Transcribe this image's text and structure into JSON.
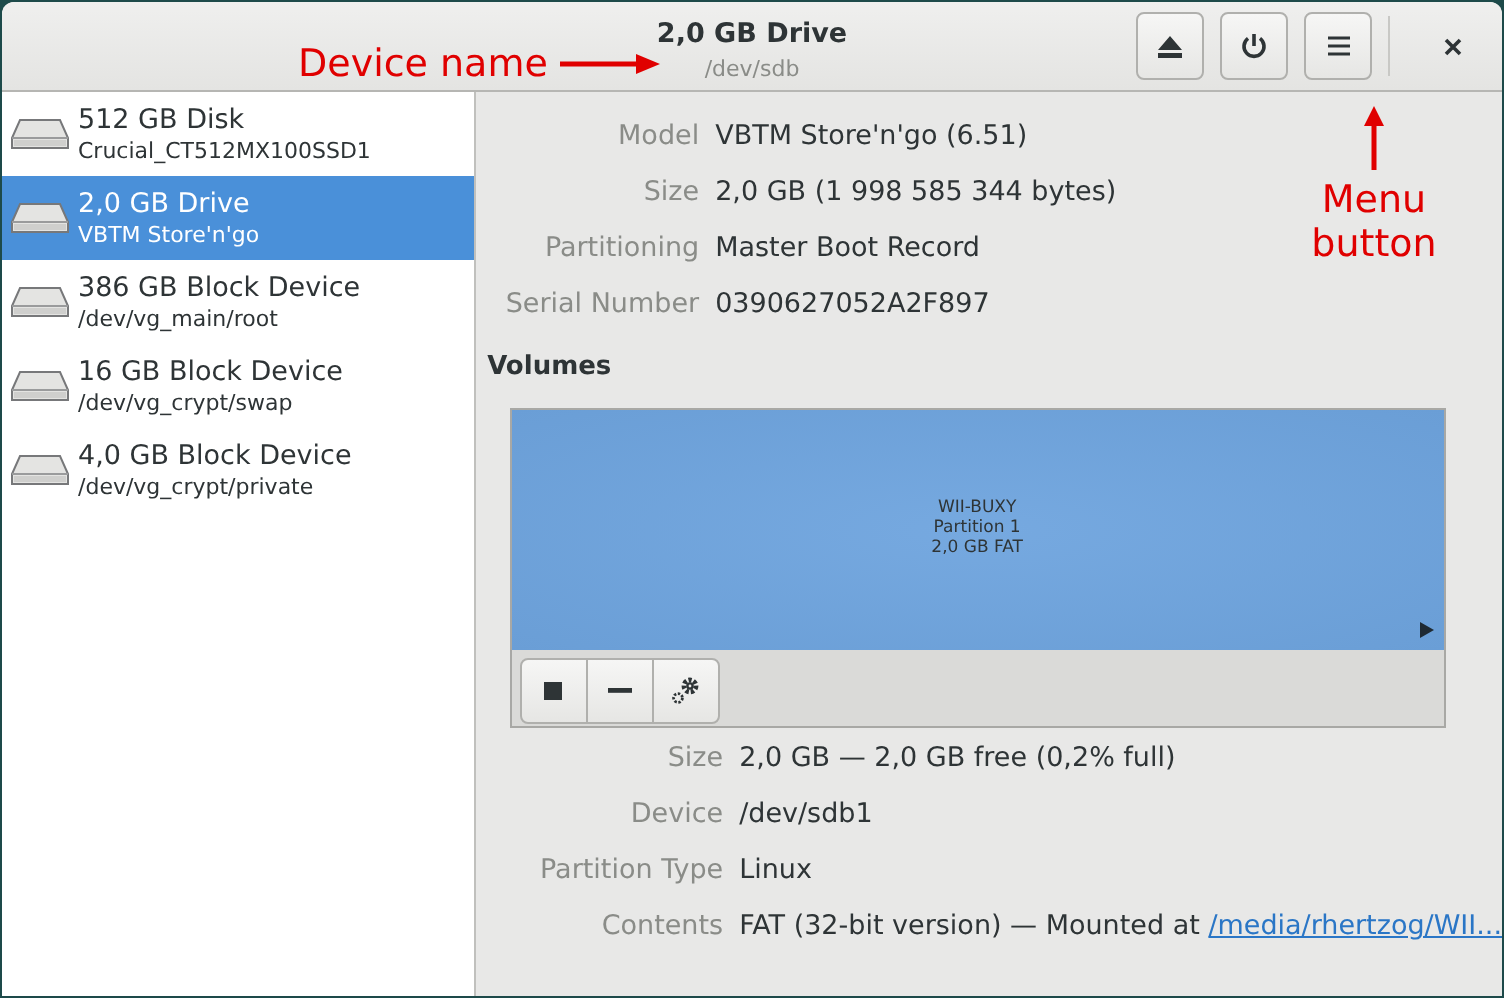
{
  "window": {
    "title": "2,0 GB Drive",
    "subtitle": "/dev/sdb"
  },
  "devices": [
    {
      "name": "512 GB Disk",
      "detail": "Crucial_CT512MX100SSD1",
      "selected": false
    },
    {
      "name": "2,0 GB Drive",
      "detail": "VBTM Store'n'go",
      "selected": true
    },
    {
      "name": "386 GB Block Device",
      "detail": "/dev/vg_main/root",
      "selected": false
    },
    {
      "name": "16 GB Block Device",
      "detail": "/dev/vg_crypt/swap",
      "selected": false
    },
    {
      "name": "4,0 GB Block Device",
      "detail": "/dev/vg_crypt/private",
      "selected": false
    }
  ],
  "drive_details": [
    {
      "label": "Model",
      "value": "VBTM Store'n'go (6.51)"
    },
    {
      "label": "Size",
      "value": "2,0 GB (1 998 585 344 bytes)"
    },
    {
      "label": "Partitioning",
      "value": "Master Boot Record"
    },
    {
      "label": "Serial Number",
      "value": "0390627052A2F897"
    }
  ],
  "volumes": {
    "heading": "Volumes",
    "partition": {
      "lines": [
        "WII-BUXY",
        "Partition 1",
        "2,0 GB FAT"
      ]
    },
    "details": [
      {
        "label": "Size",
        "value": "2,0 GB — 2,0 GB free (0,2% full)"
      },
      {
        "label": "Device",
        "value": "/dev/sdb1"
      },
      {
        "label": "Partition Type",
        "value": "Linux"
      },
      {
        "label": "Contents",
        "value": "FAT (32-bit version) — Mounted at ",
        "link": "/media/rhertzog/WII..."
      }
    ]
  },
  "annotations": [
    {
      "text": "Device name",
      "kind": "right"
    },
    {
      "text": "Menu button",
      "kind": "up"
    }
  ]
}
